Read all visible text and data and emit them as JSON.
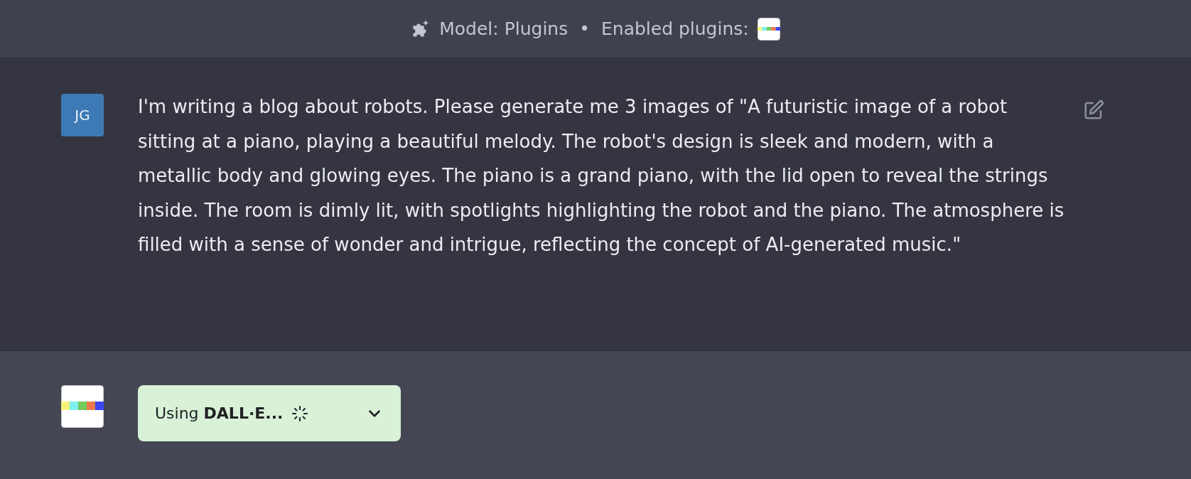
{
  "header": {
    "model": "Model: Plugins",
    "separator": "•",
    "plugins_label": "Enabled plugins:"
  },
  "messages": [
    {
      "kind": "user",
      "avatar": "JG",
      "text": "I'm writing a blog about robots. Please generate me 3 images of \"A futuristic image of a robot sitting at a piano, playing a beautiful melody. The robot's design is sleek and modern, with a metallic body and glowing eyes. The piano is a grand piano, with the lid open to reveal the strings inside. The room is dimly lit, with spotlights highlighting the robot and the piano. The atmosphere is filled with a sense of wonder and intrigue, reflecting the concept of AI-generated music.\""
    },
    {
      "kind": "plugin",
      "status": "Using **DALL·E...**",
      "expanded": false
    }
  ]
}
